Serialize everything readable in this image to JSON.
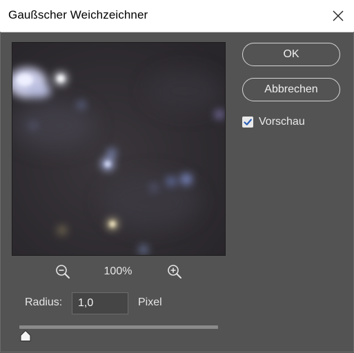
{
  "window": {
    "title": "Gaußscher Weichzeichner"
  },
  "buttons": {
    "ok_label": "OK",
    "cancel_label": "Abbrechen"
  },
  "preview_toggle": {
    "label": "Vorschau",
    "checked": true
  },
  "zoom": {
    "level": "100%"
  },
  "radius": {
    "label": "Radius:",
    "value": "1,0",
    "unit": "Pixel"
  },
  "slider": {
    "fraction": 0.03
  },
  "icons": {
    "close": "close-icon",
    "zoom_out": "zoom-out-icon",
    "zoom_in": "zoom-in-icon",
    "checkmark": "checkmark-icon",
    "slider_thumb": "slider-thumb-icon"
  },
  "colors": {
    "dialog_background": "#535353",
    "titlebar_background": "#ffffff",
    "preview_background": "#2e2b30",
    "text": "#e6e6e6"
  }
}
